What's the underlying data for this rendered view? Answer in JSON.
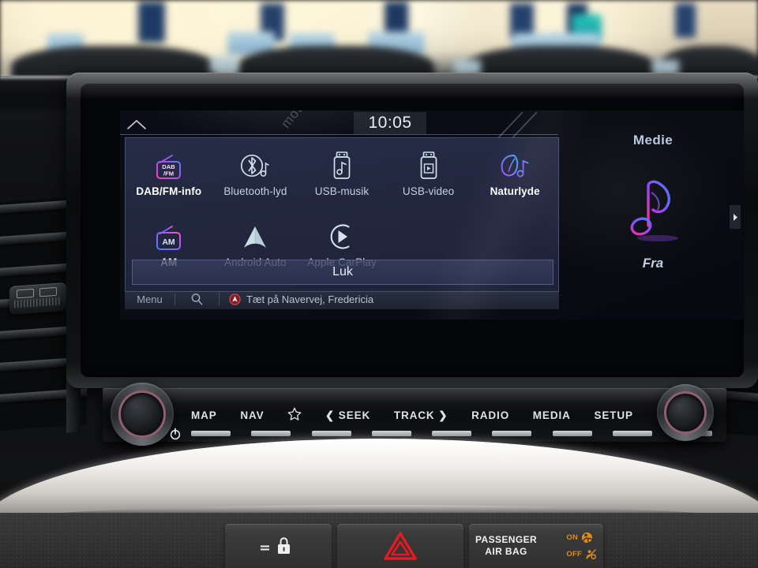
{
  "screen": {
    "clock": "10:05",
    "ghost_watermark": "moto",
    "popup": {
      "sources_row1": [
        {
          "label": "DAB/FM-info",
          "icon": "dab-fm-radio-icon",
          "active": true
        },
        {
          "label": "Bluetooth-lyd",
          "icon": "bluetooth-audio-icon",
          "active": false
        },
        {
          "label": "USB-musik",
          "icon": "usb-music-icon",
          "active": false
        },
        {
          "label": "USB-video",
          "icon": "usb-video-icon",
          "active": false
        },
        {
          "label": "Naturlyde",
          "icon": "nature-sounds-leaf-icon",
          "active": true
        }
      ],
      "sources_row2": [
        {
          "label": "AM",
          "icon": "am-radio-icon",
          "active": true
        },
        {
          "label": "Android Auto",
          "icon": "android-auto-icon",
          "active": false
        },
        {
          "label": "Apple CarPlay",
          "icon": "apple-carplay-icon",
          "active": false
        }
      ],
      "close_label": "Luk"
    },
    "navbar": {
      "menu_label": "Menu",
      "search_icon": "search-icon",
      "destination_icon": "map-marker-icon",
      "destination": "Tæt på Navervej, Fredericia"
    },
    "media_card": {
      "title": "Medie",
      "icon": "music-note-icon",
      "state": "Fra",
      "next_icon": "chevron-right-icon"
    }
  },
  "hardware": {
    "buttons": [
      {
        "label": "MAP",
        "icon": null
      },
      {
        "label": "NAV",
        "icon": null
      },
      {
        "label": "★",
        "icon": "star-favorite-icon"
      },
      {
        "label": "❮ SEEK",
        "icon": "seek-prev-icon"
      },
      {
        "label": "TRACK ❯",
        "icon": "track-next-icon"
      },
      {
        "label": "RADIO",
        "icon": null
      },
      {
        "label": "MEDIA",
        "icon": null
      },
      {
        "label": "SETUP",
        "icon": null
      }
    ],
    "left_knob": "volume-power-knob",
    "right_knob": "tune-knob",
    "power_icon": "power-icon"
  },
  "lower_dash": {
    "door_lock_icon": "door-lock-icon",
    "hazard_icon": "hazard-warning-triangle-icon",
    "airbag_line1": "PASSENGER",
    "airbag_line2": "AIR BAG",
    "airbag_on": "ON",
    "airbag_off": "OFF",
    "airbag_on_icon": "airbag-on-indicator-icon",
    "airbag_off_icon": "airbag-off-indicator-icon"
  },
  "colors": {
    "neon_magenta": "#e946c8",
    "neon_blue": "#4a7bff",
    "neon_purple": "#9b5cff",
    "icon_outline": "#cfe0ea",
    "panel_bg": "#272d48",
    "hazard_red": "#e31b23",
    "airbag_amber": "#e08a1e"
  }
}
